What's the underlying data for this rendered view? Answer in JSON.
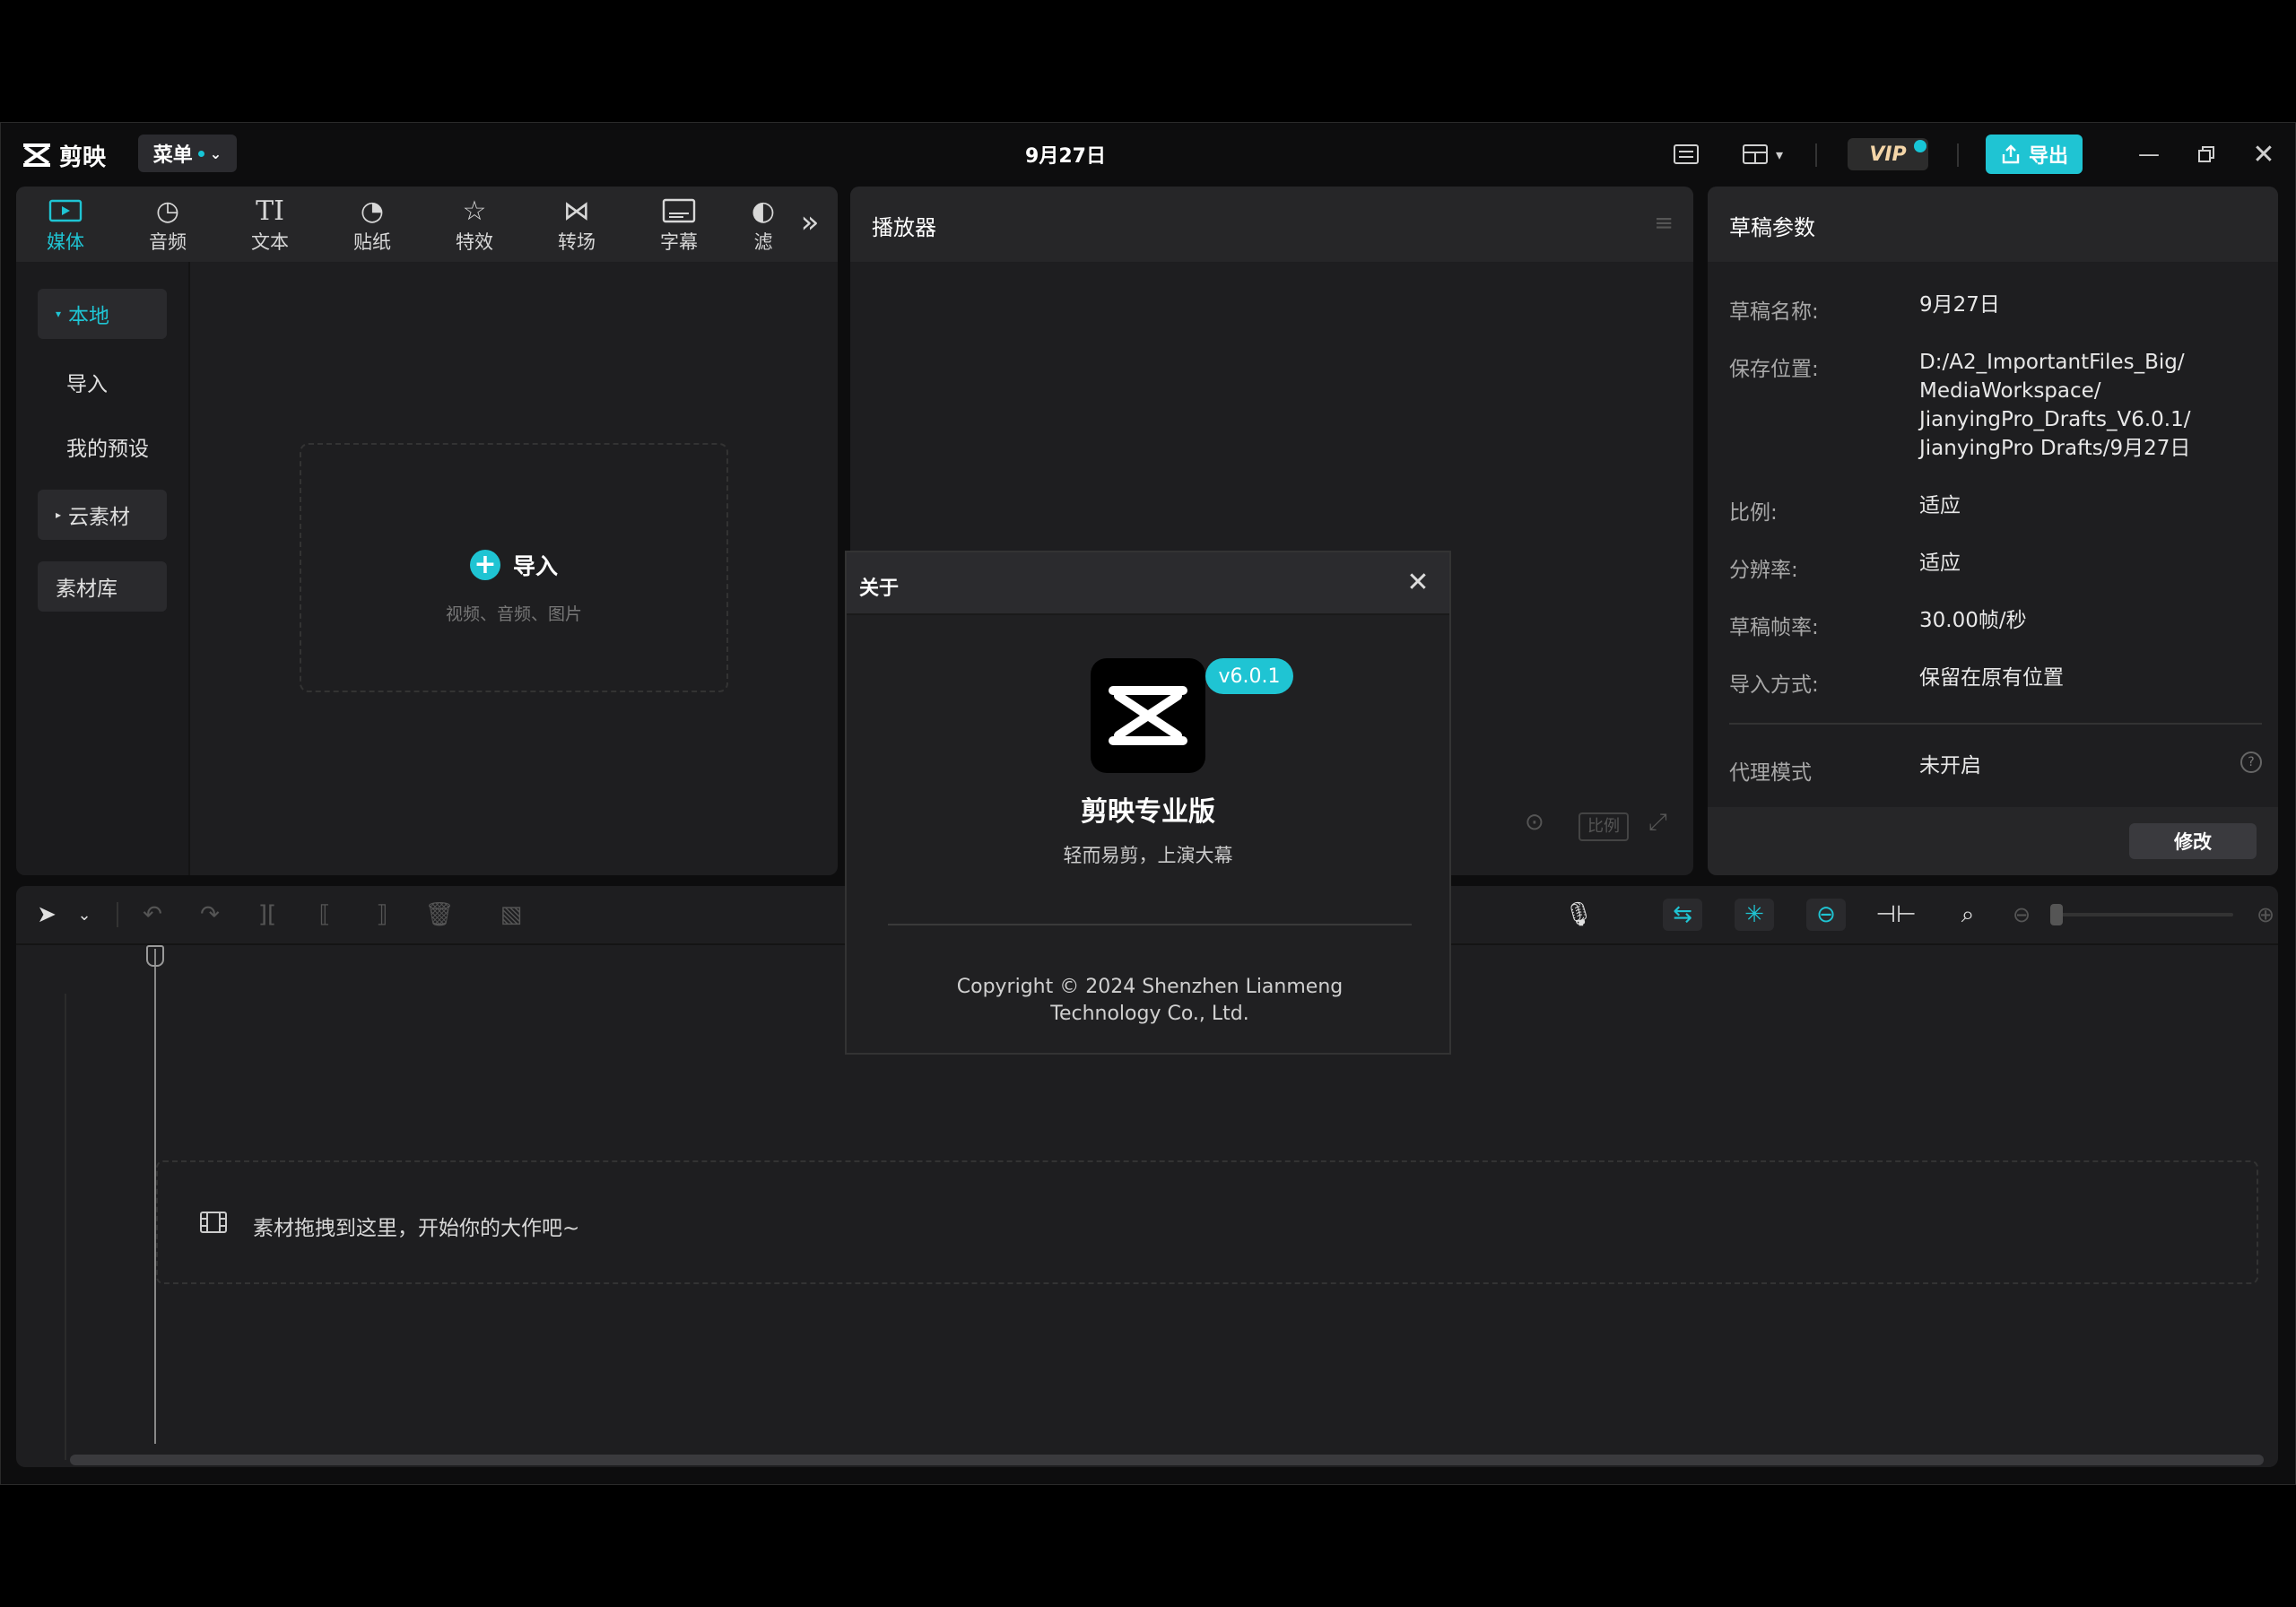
{
  "app": {
    "name": "剪映",
    "menu_label": "菜单",
    "document_title": "9月27日",
    "vip_label": "VIP",
    "export_label": "导出"
  },
  "media_tabs": [
    {
      "label": "媒体",
      "icon": "media-icon"
    },
    {
      "label": "音频",
      "icon": "audio-icon"
    },
    {
      "label": "文本",
      "icon": "text-icon"
    },
    {
      "label": "贴纸",
      "icon": "sticker-icon"
    },
    {
      "label": "特效",
      "icon": "effects-icon"
    },
    {
      "label": "转场",
      "icon": "transition-icon"
    },
    {
      "label": "字幕",
      "icon": "subtitle-icon"
    },
    {
      "label": "滤",
      "icon": "filter-icon"
    }
  ],
  "left_nav": {
    "local": "本地",
    "import": "导入",
    "presets": "我的预设",
    "cloud": "云素材",
    "library": "素材库"
  },
  "import_area": {
    "title": "导入",
    "subtitle": "视频、音频、图片"
  },
  "player": {
    "title": "播放器",
    "ratio_label": "比例"
  },
  "draft": {
    "title": "草稿参数",
    "rows": [
      {
        "label": "草稿名称:",
        "value": "9月27日"
      },
      {
        "label": "保存位置:",
        "value_lines": [
          "D:/A2_ImportantFiles_Big/",
          "MediaWorkspace/",
          "JianyingPro_Drafts_V6.0.1/",
          "JianyingPro Drafts/9月27日"
        ]
      },
      {
        "label": "比例:",
        "value": "适应"
      },
      {
        "label": "分辨率:",
        "value": "适应"
      },
      {
        "label": "草稿帧率:",
        "value": "30.00帧/秒"
      },
      {
        "label": "导入方式:",
        "value": "保留在原有位置"
      }
    ],
    "proxy_label": "代理模式",
    "proxy_value": "未开启",
    "modify_label": "修改"
  },
  "timeline": {
    "drop_hint": "素材拖拽到这里，开始你的大作吧~"
  },
  "about_dialog": {
    "title": "关于",
    "version": "v6.0.1",
    "app_name": "剪映专业版",
    "slogan": "轻而易剪，上演大幕",
    "copyright_line1": "Copyright © 2024 Shenzhen Lianmeng",
    "copyright_line2": "Technology Co., Ltd."
  },
  "colors": {
    "accent": "#1fc4d3",
    "panel": "#1e1e20",
    "background": "#000000"
  }
}
